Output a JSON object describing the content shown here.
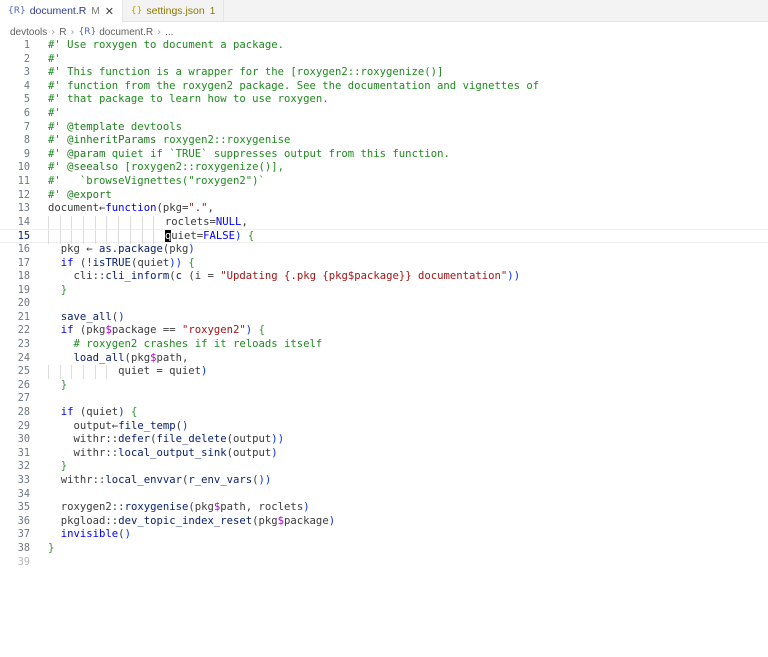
{
  "tabs": [
    {
      "icon": "{R}",
      "name": "document.R",
      "modified": "M",
      "close": "✕"
    },
    {
      "icon": "{}",
      "name": "settings.json",
      "count": "1"
    }
  ],
  "breadcrumb": {
    "items": [
      "devtools",
      "R",
      "document.R",
      "..."
    ],
    "separator": "›"
  },
  "editor": {
    "current_line": 15,
    "ghost_line": "39",
    "lines": [
      "#' Use roxygen to document a package.",
      "#'",
      "#' This function is a wrapper for the [roxygen2::roxygenize()]",
      "#' function from the roxygen2 package. See the documentation and vignettes of",
      "#' that package to learn how to use roxygen.",
      "#'",
      "#' @template devtools",
      "#' @inheritParams roxygen2::roxygenise",
      "#' @param quiet if `TRUE` suppresses output from this function.",
      "#' @seealso [roxygen2::roxygenize()],",
      "#'   `browseVignettes(\"roxygen2\")`",
      "#' @export",
      "document←function(pkg=\".\",",
      "roclets=NULL,",
      "quiet=FALSE) {",
      "  pkg ← as.package(pkg)",
      "  if (!isTRUE(quiet)) {",
      "    cli::cli_inform(c (i = \"Updating {.pkg {pkg$package}} documentation\"))",
      "  }",
      "",
      "  save_all()",
      "  if (pkg$package == \"roxygen2\") {",
      "    # roxygen2 crashes if it reloads itself",
      "    load_all(pkg$path,",
      "quiet = quiet)",
      "  }",
      "",
      "  if (quiet) {",
      "    output←file_temp()",
      "    withr::defer(file_delete(output))",
      "    withr::local_output_sink(output)",
      "  }",
      "  withr::local_envvar(r_env_vars())",
      "",
      "  roxygen2::roxygenise(pkg$path, roclets)",
      "  pkgload::dev_topic_index_reset(pkg$package)",
      "  invisible()",
      "}"
    ]
  },
  "colors": {
    "comment": "#1f8a1f",
    "keyword": "#0000ff",
    "string": "#a31515",
    "function": "#0b216f",
    "cursor_line_number": "#0b216f"
  }
}
